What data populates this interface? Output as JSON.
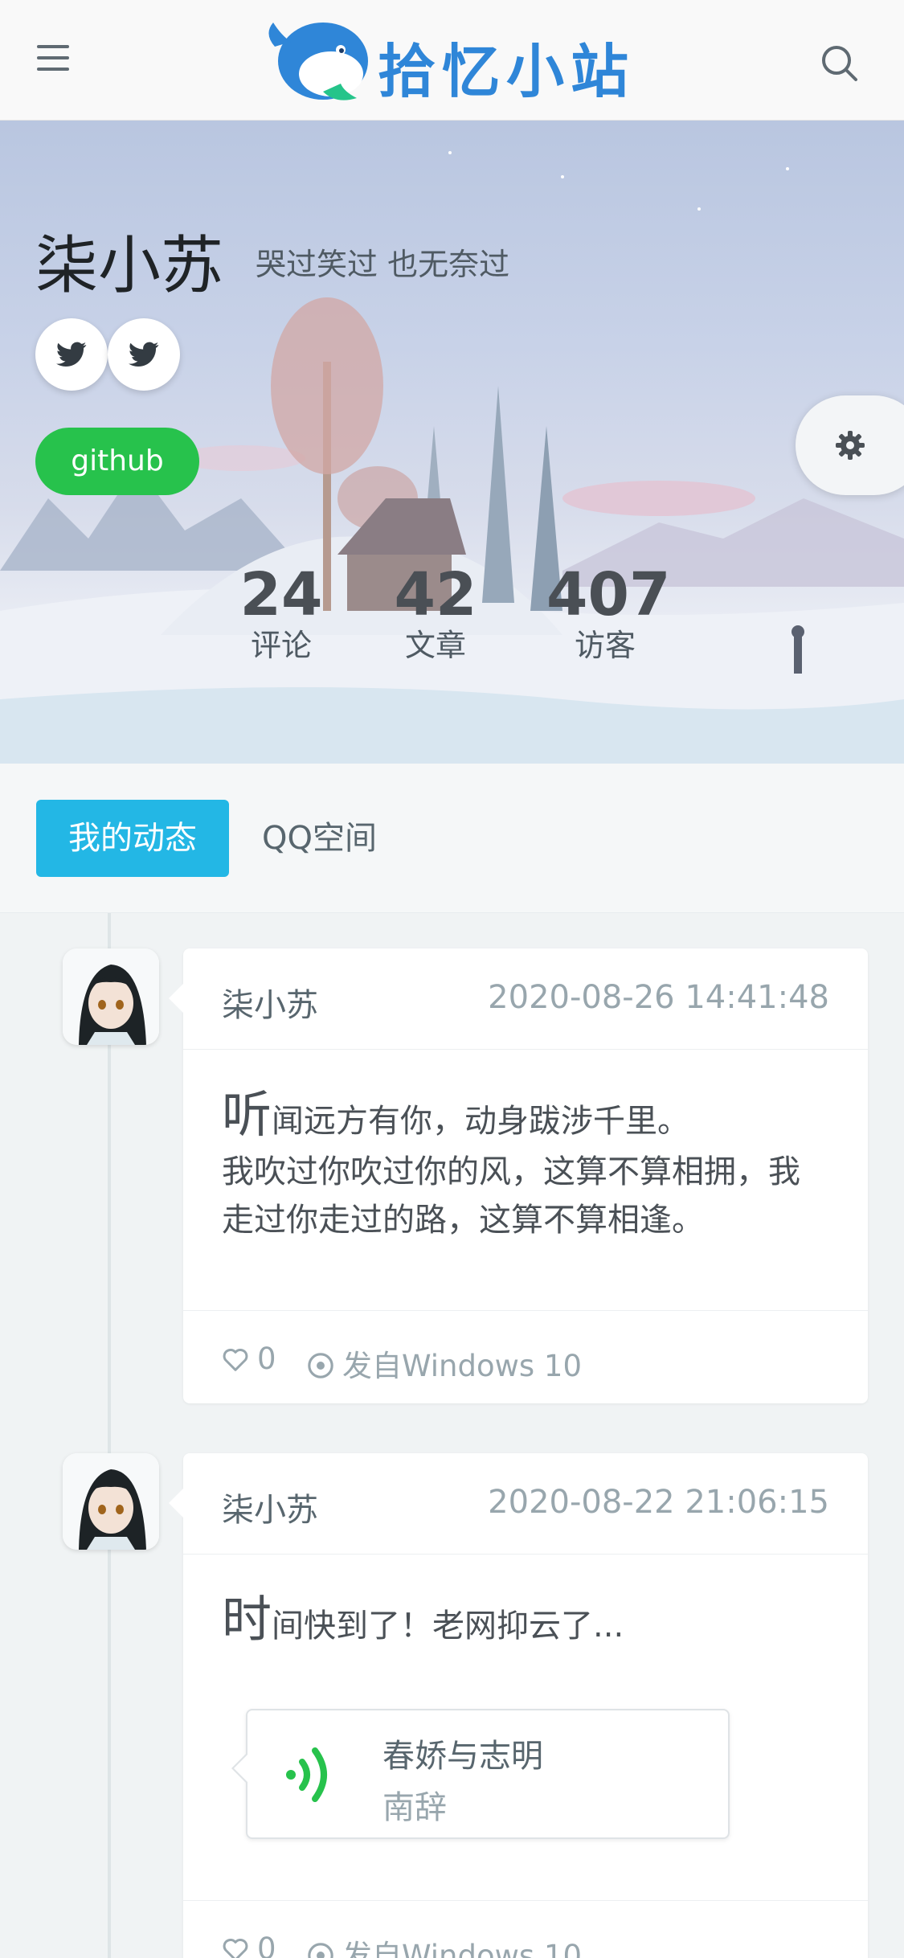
{
  "header": {
    "logo_text": "拾忆小站",
    "menu_icon": "hamburger-menu-icon",
    "search_icon": "search-icon",
    "brand_color": "#2f86d8"
  },
  "profile": {
    "name": "柒小苏",
    "motto": "哭过笑过 也无奈过",
    "social_icons": [
      "twitter-icon",
      "twitter-icon"
    ],
    "github_label": "github",
    "settings_icon": "gear-icon",
    "stats": [
      {
        "value": "24",
        "label": "评论"
      },
      {
        "value": "42",
        "label": "文章"
      },
      {
        "value": "407",
        "label": "访客"
      }
    ]
  },
  "tabs": [
    {
      "label": "我的动态",
      "active": true
    },
    {
      "label": "QQ空间",
      "active": false
    }
  ],
  "posts": [
    {
      "author": "柒小苏",
      "time": "2020-08-26 14:41:48",
      "dropcap": "听",
      "first_line_rest": "闻远方有你，动身跋涉千里。",
      "body": "我吹过你吹过你的风，这算不算相拥，我走过你走过的路，这算不算相逢。",
      "likes": "0",
      "device": "发自Windows 10"
    },
    {
      "author": "柒小苏",
      "time": "2020-08-22 21:06:15",
      "dropcap": "时",
      "first_line_rest": "间快到了！老网抑云了...",
      "music": {
        "title": "春娇与志明",
        "artist": "南辞"
      },
      "likes": "0",
      "device": "发自Windows 10"
    }
  ],
  "colors": {
    "accent": "#23b7e5",
    "github": "#27c24c",
    "music_icon": "#27c24c"
  }
}
